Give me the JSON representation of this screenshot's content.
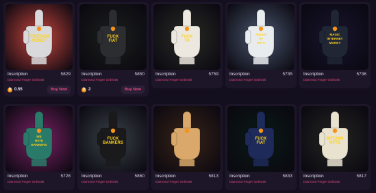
{
  "cards": [
    {
      "name": "Inscription",
      "number": "5829",
      "collection": "Diamond Finger Ordinals",
      "price": "0.55",
      "buy_label": "Buy Now",
      "hand_text": "FREEDOM MONEY",
      "bg": "#c8453e",
      "hand": "#d9d9dc",
      "icon": "bitcoin-icon"
    },
    {
      "name": "Inscription",
      "number": "5850",
      "collection": "Diamond Finger Ordinals",
      "price": "2",
      "buy_label": "Buy Now",
      "hand_text": "FUCK FIAT",
      "bg": "#1c1f1c",
      "hand": "#2b2d31",
      "icon": "bitcoin-icon"
    },
    {
      "name": "Inscription",
      "number": "5759",
      "collection": "Diamond Finger Ordinals",
      "hand_text": "FUCK YA",
      "bg": "#2a2b26",
      "hand": "#ece8df"
    },
    {
      "name": "Inscription",
      "number": "5735",
      "collection": "Diamond Finger Ordinals",
      "hand_text": "RULES OF DATA",
      "bg": "#4b5870",
      "hand": "#e9ecef"
    },
    {
      "name": "Inscription",
      "number": "5736",
      "collection": "Diamond Finger Ordinals",
      "hand_text": "MAGIC INTERNET MONEY",
      "bg": "#18152e",
      "hand": "#202634"
    },
    {
      "name": "Inscription",
      "number": "5728",
      "collection": "Diamond Finger Ordinals",
      "hand_text": "WE HATE BANKERS",
      "bg": "#7c2266",
      "hand": "#2a7a6a"
    },
    {
      "name": "Inscription",
      "number": "5860",
      "collection": "Diamond Finger Ordinals",
      "hand_text": "FUCK BANKERS",
      "bg": "#3a4248",
      "hand": "#1a1a1c"
    },
    {
      "name": "Inscription",
      "number": "5813",
      "collection": "Diamond Finger Ordinals",
      "hand_text": "",
      "bg": "#3a2418",
      "hand": "#d9a86a"
    },
    {
      "name": "Inscription",
      "number": "5833",
      "collection": "Diamond Finger Ordinals",
      "hand_text": "FUCK FIAT",
      "bg": "#0b1a16",
      "hand": "#1d2a5a"
    },
    {
      "name": "Inscription",
      "number": "5817",
      "collection": "Diamond Finger Ordinals",
      "hand_text": "BITCOIN NFTS",
      "bg": "#252522",
      "hand": "#e8e2cf"
    }
  ]
}
